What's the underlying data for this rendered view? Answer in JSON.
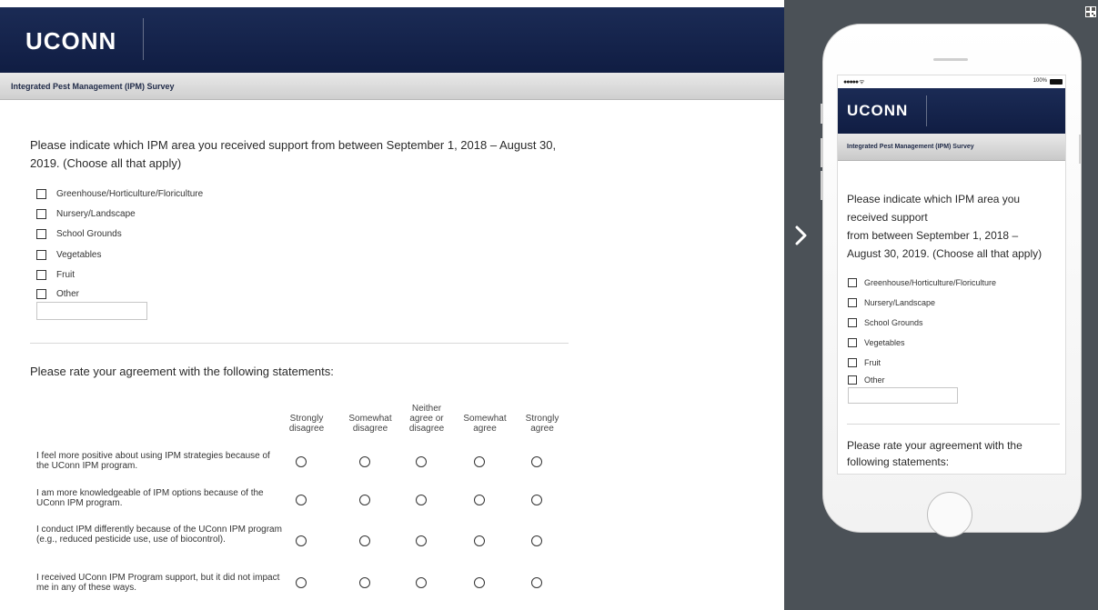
{
  "survey": {
    "logo": "UCONN",
    "title": "Integrated Pest Management (IPM) Survey",
    "question1": "Please indicate which IPM area you received support from between September 1, 2018 – August 30, 2019. (Choose all that apply)",
    "options": [
      "Greenhouse/Horticulture/Floriculture",
      "Nursery/Landscape",
      "School Grounds",
      "Vegetables",
      "Fruit",
      "Other"
    ],
    "question2": "Please rate your agreement with the following statements:",
    "scale": [
      "Strongly disagree",
      "Somewhat disagree",
      "Neither agree or disagree",
      "Somewhat agree",
      "Strongly agree"
    ],
    "statements": [
      "I feel more positive about using IPM strategies because of the UConn IPM program.",
      "I am more knowledgeable of IPM options because of the UConn IPM program.",
      "I conduct IPM differently because of the UConn IPM program (e.g., reduced pesticide use, use of biocontrol).",
      "I received UConn IPM Program support, but it did not impact me in any of these ways."
    ]
  },
  "mobile": {
    "status_signal": "●●●●● ᯤ",
    "battery": "100%",
    "question1_line1": "Please indicate which IPM area you",
    "question1_line2": "received support",
    "question1_line3": "from between September 1, 2018 –",
    "question1_line4": "August 30, 2019. (Choose all that apply)",
    "question2_line1": "Please rate your agreement with the",
    "question2_line2": "following statements:"
  },
  "colors": {
    "header_navy": "#14224b",
    "side_panel": "#4b5157"
  },
  "icons": [
    "chevron-right-icon",
    "qr-code-icon"
  ]
}
